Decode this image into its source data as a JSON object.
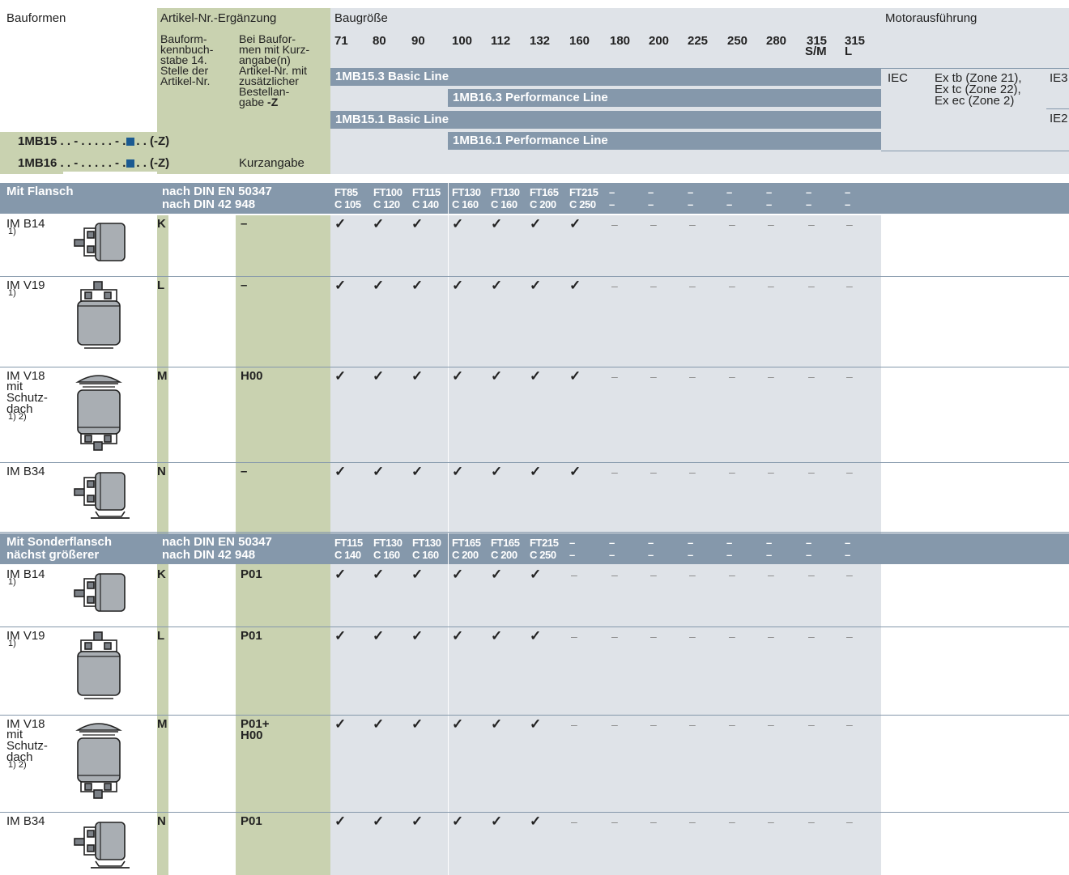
{
  "header": {
    "col_bauformen": "Bauformen",
    "col_artikel": "Artikel-Nr.-Ergänzung",
    "col_baugroesse": "Baugröße",
    "col_motor": "Motorausführung",
    "sub_kennbuchstabe": [
      "Bauform-",
      "kennbuch-",
      "stabe 14.",
      "Stelle der",
      "Artikel-Nr."
    ],
    "sub_kurzangabe": [
      "Bei Baufor-",
      "men mit Kurz-",
      "angabe(n)",
      "Artikel-Nr. mit",
      "zusätzlicher",
      "Bestellan-"
    ],
    "sub_kurzangabe_last_pre": "gabe ",
    "sub_kurzangabe_last_bold": "-Z",
    "kurzangabe_label": "Kurzangabe",
    "sizes": [
      "71",
      "80",
      "90",
      "100",
      "112",
      "132",
      "160",
      "180",
      "200",
      "225",
      "250",
      "280",
      "315",
      "315"
    ],
    "sizes_sub": [
      "",
      "",
      "",
      "",
      "",
      "",
      "",
      "",
      "",
      "",
      "",
      "",
      "S/M",
      "L"
    ],
    "order_1mb15_pre": "1MB15 . . - . . . . . - .",
    "order_1mb15_post": ". . (-Z)",
    "order_1mb16_pre": "1MB16 . . - . . . . . - .",
    "order_1mb16_post": ". . (-Z)",
    "lines": [
      "1MB15.3 Basic Line",
      "1MB16.3 Performance Line",
      "1MB15.1 Basic Line",
      "1MB16.1 Performance Line"
    ],
    "motor_iec": "IEC",
    "motor_ex": [
      "Ex tb (Zone 21),",
      "Ex tc (Zone 22),",
      "Ex ec (Zone 2)"
    ],
    "motor_ie3": "IE3",
    "motor_ie2": "IE2"
  },
  "sections": [
    {
      "title": "Mit Flansch",
      "title2": "",
      "norm1": "nach DIN EN 50347",
      "norm2": "nach DIN 42 948",
      "flange_top": [
        "FT85",
        "FT100",
        "FT115",
        "FT130",
        "FT130",
        "FT165",
        "FT215",
        "–",
        "–",
        "–",
        "–",
        "–",
        "–",
        "–"
      ],
      "flange_bot": [
        "C 105",
        "C 120",
        "C 140",
        "C 160",
        "C 160",
        "C 200",
        "C 250",
        "–",
        "–",
        "–",
        "–",
        "–",
        "–",
        "–"
      ],
      "rows": [
        {
          "name": "IM B14",
          "extra": "",
          "note": "1)",
          "letter": "K",
          "code": "–",
          "marks": [
            "✓",
            "✓",
            "✓",
            "✓",
            "✓",
            "✓",
            "✓",
            "–",
            "–",
            "–",
            "–",
            "–",
            "–",
            "–"
          ]
        },
        {
          "name": "IM V19",
          "extra": "",
          "note": "1)",
          "letter": "L",
          "code": "–",
          "marks": [
            "✓",
            "✓",
            "✓",
            "✓",
            "✓",
            "✓",
            "✓",
            "–",
            "–",
            "–",
            "–",
            "–",
            "–",
            "–"
          ]
        },
        {
          "name": "IM V18",
          "extra": "mit Schutz- dach",
          "note": "1) 2)",
          "letter": "M",
          "code": "H00",
          "marks": [
            "✓",
            "✓",
            "✓",
            "✓",
            "✓",
            "✓",
            "✓",
            "–",
            "–",
            "–",
            "–",
            "–",
            "–",
            "–"
          ]
        },
        {
          "name": "IM B34",
          "extra": "",
          "note": "",
          "letter": "N",
          "code": "–",
          "marks": [
            "✓",
            "✓",
            "✓",
            "✓",
            "✓",
            "✓",
            "✓",
            "–",
            "–",
            "–",
            "–",
            "–",
            "–",
            "–"
          ]
        }
      ]
    },
    {
      "title": "Mit Sonderflansch",
      "title2": "nächst größerer",
      "norm1": "nach DIN EN 50347",
      "norm2": "nach DIN 42 948",
      "flange_top": [
        "FT115",
        "FT130",
        "FT130",
        "FT165",
        "FT165",
        "FT215",
        "–",
        "–",
        "–",
        "–",
        "–",
        "–",
        "–",
        "–"
      ],
      "flange_bot": [
        "C 140",
        "C 160",
        "C 160",
        "C 200",
        "C 200",
        "C 250",
        "–",
        "–",
        "–",
        "–",
        "–",
        "–",
        "–",
        "–"
      ],
      "rows": [
        {
          "name": "IM B14",
          "extra": "",
          "note": "1)",
          "letter": "K",
          "code": "P01",
          "marks": [
            "✓",
            "✓",
            "✓",
            "✓",
            "✓",
            "✓",
            "–",
            "–",
            "–",
            "–",
            "–",
            "–",
            "–",
            "–"
          ]
        },
        {
          "name": "IM V19",
          "extra": "",
          "note": "1)",
          "letter": "L",
          "code": "P01",
          "marks": [
            "✓",
            "✓",
            "✓",
            "✓",
            "✓",
            "✓",
            "–",
            "–",
            "–",
            "–",
            "–",
            "–",
            "–",
            "–"
          ]
        },
        {
          "name": "IM V18",
          "extra": "mit Schutz- dach",
          "note": "1) 2)",
          "letter": "M",
          "code": "P01+ H00",
          "marks": [
            "✓",
            "✓",
            "✓",
            "✓",
            "✓",
            "✓",
            "–",
            "–",
            "–",
            "–",
            "–",
            "–",
            "–",
            "–"
          ]
        },
        {
          "name": "IM B34",
          "extra": "",
          "note": "",
          "letter": "N",
          "code": "P01",
          "marks": [
            "✓",
            "✓",
            "✓",
            "✓",
            "✓",
            "✓",
            "–",
            "–",
            "–",
            "–",
            "–",
            "–",
            "–",
            "–"
          ]
        }
      ]
    }
  ]
}
